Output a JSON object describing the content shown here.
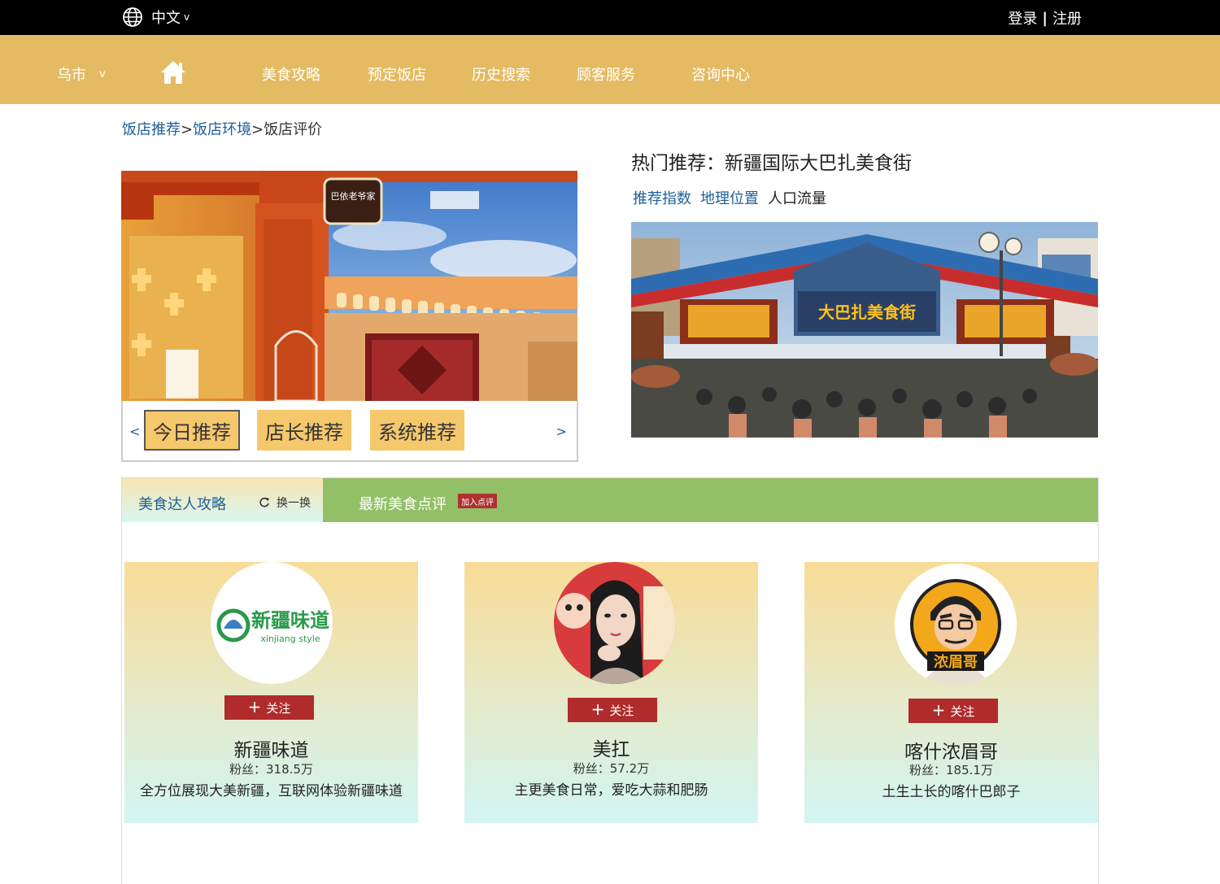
{
  "topbar": {
    "language": "中文",
    "login": "登录",
    "separator": "|",
    "register": "注册"
  },
  "nav": {
    "city": "乌市",
    "items": [
      "美食攻略",
      "预定饭店",
      "历史搜索",
      "顾客服务",
      "咨询中心"
    ]
  },
  "breadcrumb": {
    "items": [
      "饭店推荐",
      "饭店环境",
      "饭店评价"
    ],
    "separator": ">"
  },
  "carousel": {
    "prev": "<",
    "next": ">",
    "buttons": [
      "今日推荐",
      "店长推荐",
      "系统推荐"
    ],
    "active": "今日推荐"
  },
  "hot": {
    "title": "热门推荐：新疆国际大巴扎美食街",
    "tabs": [
      "推荐指数",
      "地理位置",
      "人口流量"
    ],
    "gate_sign": "大巴扎美食街"
  },
  "panel": {
    "tab_guides": "美食达人攻略",
    "refresh": "换一换",
    "tab_reviews": "最新美食点评",
    "join_badge": "加入点评",
    "follow_label": "关注",
    "cards": [
      {
        "name": "新疆味道",
        "fans": "粉丝：318.5万",
        "desc": "全方位展现大美新疆，互联网体验新疆味道",
        "logo_text": "新疆味道",
        "logo_sub": "xinjiang style"
      },
      {
        "name": "美扛",
        "fans": "粉丝：57.2万",
        "desc": "主更美食日常，爱吃大蒜和肥肠"
      },
      {
        "name": "喀什浓眉哥",
        "fans": "粉丝：185.1万",
        "desc": "土生土长的喀什巴郎子",
        "logo_text": "浓眉哥"
      }
    ]
  },
  "colors": {
    "nav_bg": "#e4bb62",
    "tab_green": "#93c066",
    "link_blue": "#1e5f99",
    "follow_red": "#b02b2b",
    "rec_btn": "#f6c86c"
  }
}
